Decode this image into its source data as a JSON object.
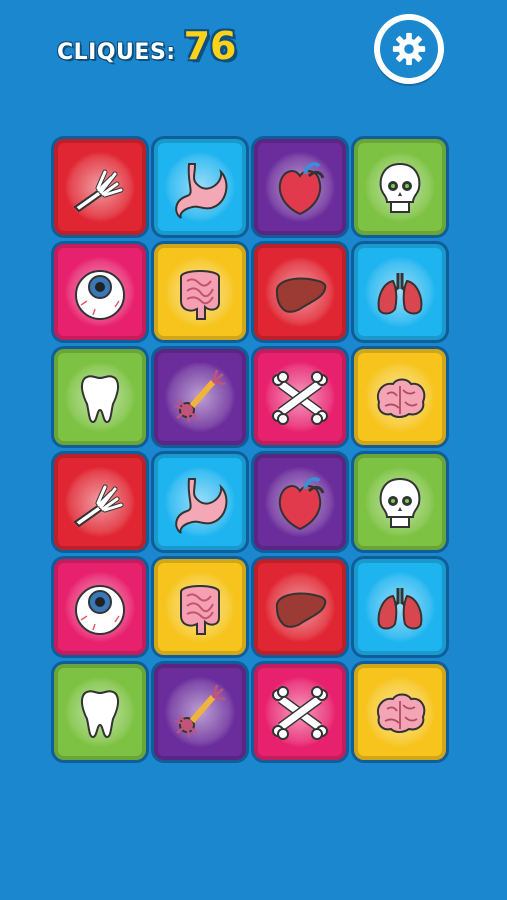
{
  "hud": {
    "clicks_label": "CLIQUES:",
    "clicks_value": "76"
  },
  "colors": {
    "background": "#1a87cf",
    "red": "#e02632",
    "blue": "#1eb4f0",
    "purple": "#6b2d9b",
    "green": "#7dc242",
    "pink": "#e8216e",
    "yellow": "#f6c41c"
  },
  "board": {
    "columns": 4,
    "rows": 6,
    "cards": [
      {
        "icon": "skeleton-hand-icon",
        "color": "red"
      },
      {
        "icon": "stomach-icon",
        "color": "blue"
      },
      {
        "icon": "heart-icon",
        "color": "purple"
      },
      {
        "icon": "skull-icon",
        "color": "green"
      },
      {
        "icon": "eyeball-icon",
        "color": "pink"
      },
      {
        "icon": "intestines-icon",
        "color": "yellow"
      },
      {
        "icon": "liver-icon",
        "color": "red"
      },
      {
        "icon": "lungs-icon",
        "color": "blue"
      },
      {
        "icon": "tooth-icon",
        "color": "green"
      },
      {
        "icon": "neuron-icon",
        "color": "purple"
      },
      {
        "icon": "crossbones-icon",
        "color": "pink"
      },
      {
        "icon": "brain-icon",
        "color": "yellow"
      },
      {
        "icon": "skeleton-hand-icon",
        "color": "red"
      },
      {
        "icon": "stomach-icon",
        "color": "blue"
      },
      {
        "icon": "heart-icon",
        "color": "purple"
      },
      {
        "icon": "skull-icon",
        "color": "green"
      },
      {
        "icon": "eyeball-icon",
        "color": "pink"
      },
      {
        "icon": "intestines-icon",
        "color": "yellow"
      },
      {
        "icon": "liver-icon",
        "color": "red"
      },
      {
        "icon": "lungs-icon",
        "color": "blue"
      },
      {
        "icon": "tooth-icon",
        "color": "green"
      },
      {
        "icon": "neuron-icon",
        "color": "purple"
      },
      {
        "icon": "crossbones-icon",
        "color": "pink"
      },
      {
        "icon": "brain-icon",
        "color": "yellow"
      }
    ]
  }
}
